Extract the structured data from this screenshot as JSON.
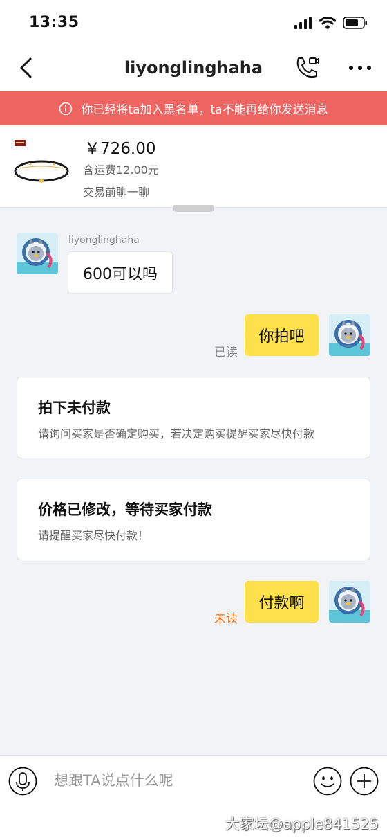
{
  "status_bar": {
    "time": "13:35",
    "icons": [
      "signal-icon",
      "wifi-icon",
      "battery-icon"
    ]
  },
  "nav": {
    "title": "liyonglinghaha",
    "icons": [
      "back-icon",
      "phone-icon",
      "more-icon"
    ]
  },
  "banner": {
    "text": "你已经将ta加入黑名单，ta不能再给你发送消息",
    "icon": "info-icon",
    "color": "#ee6461"
  },
  "product": {
    "price": "￥726.00",
    "shipping": "含运费12.00元",
    "prompt": "交易前聊一聊"
  },
  "messages": [
    {
      "from": "other",
      "sender_name": "liyonglinghaha",
      "text": "600可以吗"
    },
    {
      "from": "me",
      "text": "你拍吧",
      "status": "已读"
    },
    {
      "from": "system",
      "title": "拍下未付款",
      "desc": "请询问买家是否确定购买，若决定购买提醒买家尽快付款"
    },
    {
      "from": "system",
      "title": "价格已修改，等待买家付款",
      "desc": "请提醒买家尽快付款！"
    },
    {
      "from": "me",
      "text": "付款啊",
      "status": "未读"
    }
  ],
  "input_bar": {
    "placeholder": "想跟TA说点什么呢",
    "icons": [
      "mic-icon",
      "emoji-icon",
      "plus-icon"
    ]
  },
  "watermark": "大家坛@apple841525",
  "colors": {
    "accent_yellow": "#fde04a",
    "unread_orange": "#e5771f",
    "read_gray": "#888888"
  }
}
